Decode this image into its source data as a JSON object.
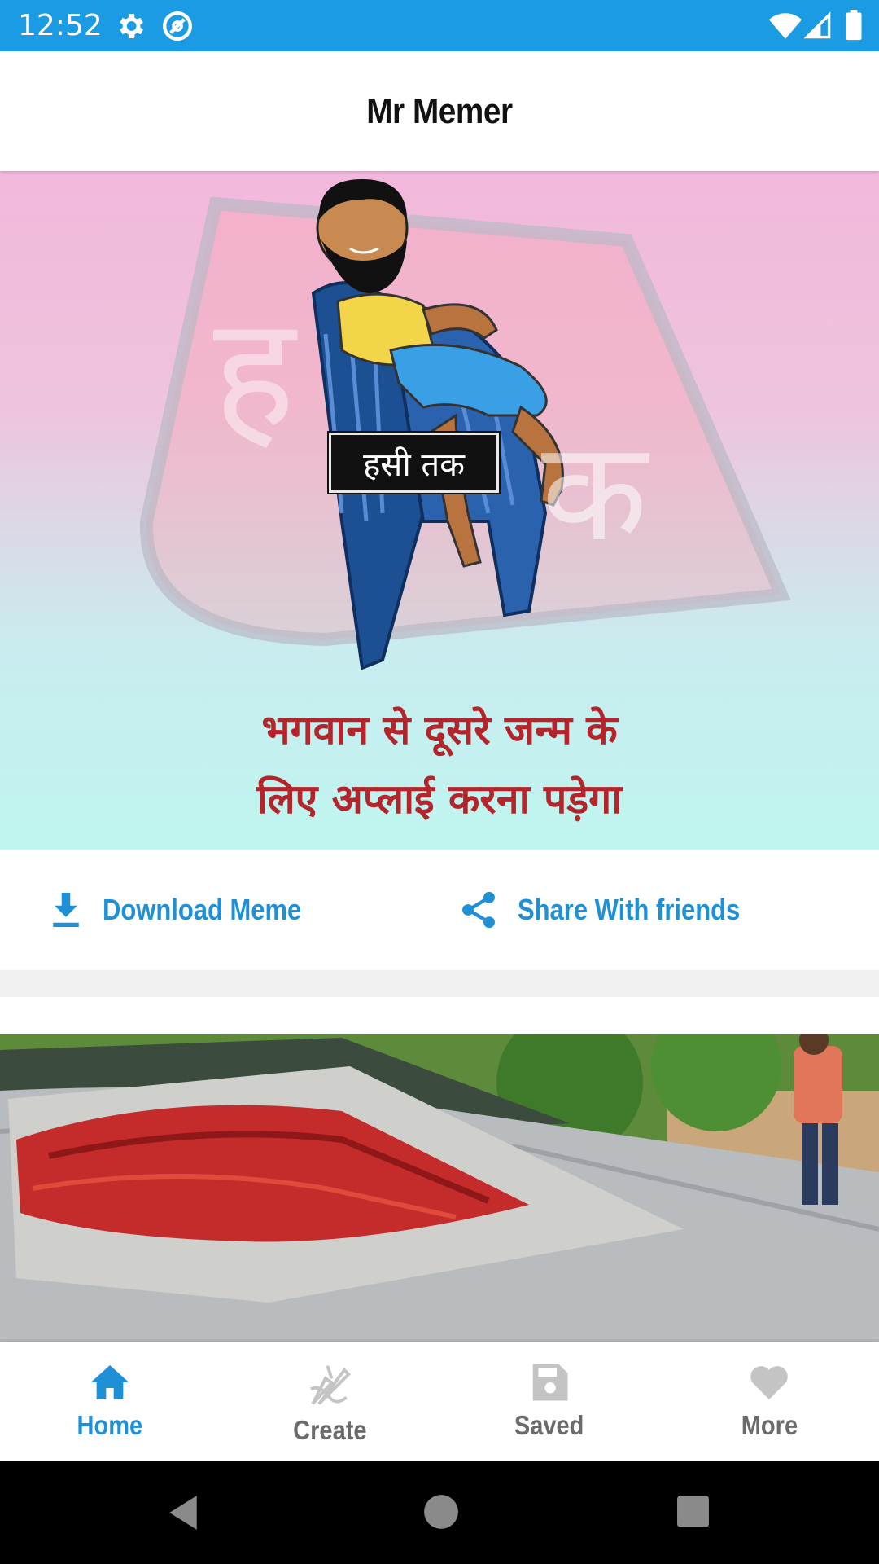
{
  "status_bar": {
    "time": "12:52",
    "icons": [
      "gear-icon",
      "at-sign-icon",
      "wifi-icon",
      "cellular-signal-icon",
      "battery-icon"
    ]
  },
  "app_bar": {
    "title": "Mr Memer"
  },
  "feed": {
    "meme1": {
      "badge_text": "हसी तक",
      "watermark_chars": [
        "ह",
        "क"
      ],
      "caption_line1": "भगवान से दूसरे जन्म के",
      "caption_line2": "लिए अप्लाई करना पड़ेगा"
    },
    "actions": {
      "download_label": "Download Meme",
      "share_label": "Share With friends"
    }
  },
  "bottom_nav": {
    "items": [
      {
        "label": "Home",
        "icon": "home-icon",
        "active": true
      },
      {
        "label": "Create",
        "icon": "pen-brush-icon",
        "active": false
      },
      {
        "label": "Saved",
        "icon": "save-floppy-icon",
        "active": false
      },
      {
        "label": "More",
        "icon": "heart-icon",
        "active": false
      }
    ]
  },
  "colors": {
    "status_bar": "#1a9be3",
    "accent": "#1f8fd6",
    "inactive": "#6b6b6b",
    "caption_red": "#b3252a"
  }
}
